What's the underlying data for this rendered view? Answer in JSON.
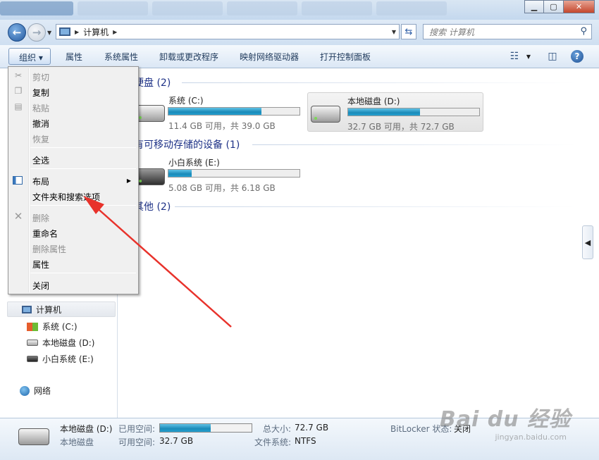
{
  "window": {
    "min_label": "▁",
    "max_label": "▢",
    "close_label": "✕"
  },
  "address": {
    "location": "计算机",
    "search_placeholder": "搜索 计算机"
  },
  "toolbar": {
    "organize": "组织 ▾",
    "items": [
      "属性",
      "系统属性",
      "卸载或更改程序",
      "映射网络驱动器",
      "打开控制面板"
    ]
  },
  "nav": {
    "computer": "计算机",
    "drive_c": "系统 (C:)",
    "drive_d": "本地磁盘 (D:)",
    "drive_e": "小白系统 (E:)",
    "network": "网络"
  },
  "content": {
    "group_hdd": "硬盘 (2)",
    "group_removable": "有可移动存储的设备 (1)",
    "group_other": "其他 (2)",
    "drives": [
      {
        "name": "系统 (C:)",
        "free": "11.4 GB 可用，共 39.0 GB",
        "used_fraction": 0.71
      },
      {
        "name": "本地磁盘 (D:)",
        "free": "32.7 GB 可用，共 72.7 GB",
        "used_fraction": 0.55
      },
      {
        "name": "小白系统 (E:)",
        "free": "5.08 GB 可用，共 6.18 GB",
        "used_fraction": 0.18
      }
    ]
  },
  "menu": {
    "cut": "剪切",
    "copy": "复制",
    "paste": "粘贴",
    "undo": "撤消",
    "redo": "恢复",
    "select_all": "全选",
    "layout": "布局",
    "folder_options": "文件夹和搜索选项",
    "delete": "删除",
    "rename": "重命名",
    "remove_props": "删除属性",
    "properties": "属性",
    "close": "关闭"
  },
  "details": {
    "drive_name": "本地磁盘 (D:)",
    "drive_type": "本地磁盘",
    "used_label": "已用空间:",
    "free_label": "可用空间:",
    "free_value": "32.7 GB",
    "total_label": "总大小:",
    "total_value": "72.7 GB",
    "fs_label": "文件系统:",
    "fs_value": "NTFS",
    "bitlocker_label": "BitLocker 状态:",
    "bitlocker_value": "关闭",
    "used_fraction": 0.55
  },
  "watermark": {
    "brand": "Bai du 经验",
    "url": "jingyan.baidu.com"
  },
  "colors": {
    "annotation_arrow": "#e8322b",
    "bar_fill": "#1a8ab8"
  }
}
